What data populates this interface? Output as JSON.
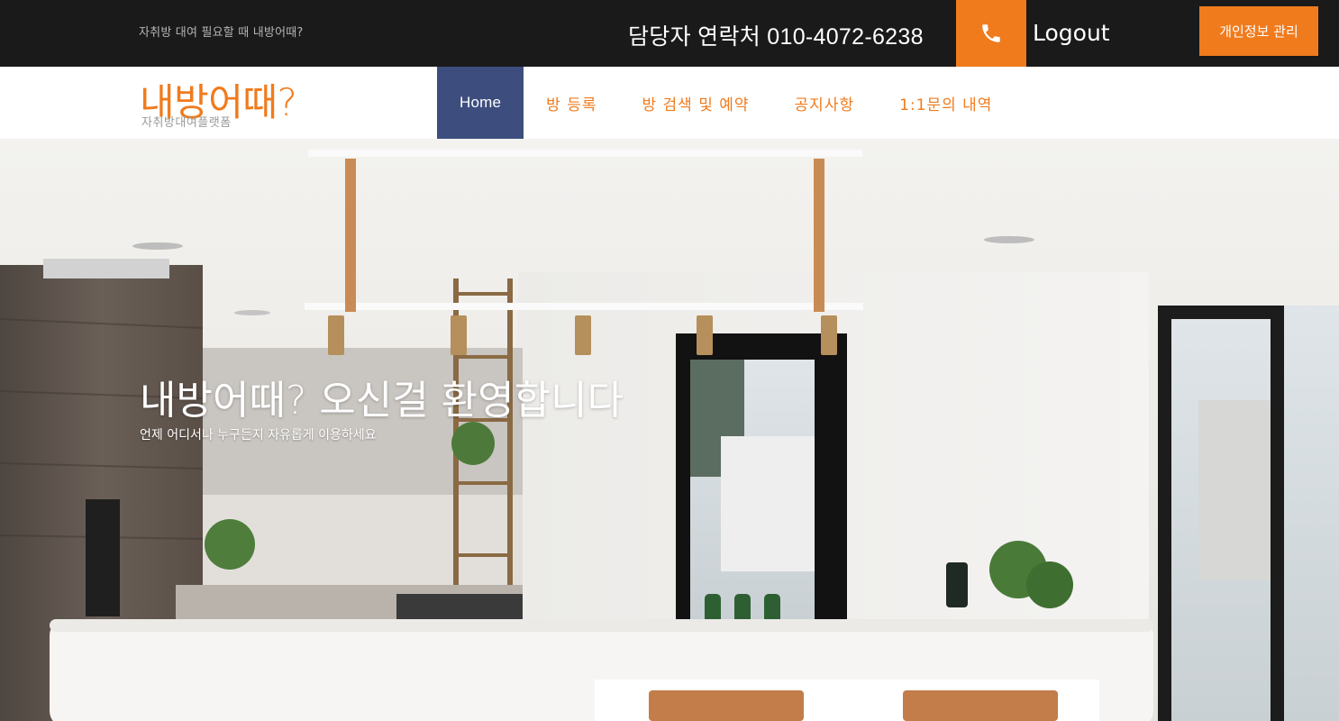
{
  "topbar": {
    "tagline": "자취방 대여 필요할 때 내방어때?",
    "contact": "담당자 연락처 010-4072-6238",
    "phone_icon": "phone-icon",
    "logout_label": "Logout",
    "profile_button": "개인정보 관리"
  },
  "header": {
    "logo_title": "내방어때?",
    "logo_subtitle": "자취방대여플랫폼",
    "nav": [
      {
        "label": "Home",
        "active": true
      },
      {
        "label": "방 등록",
        "active": false
      },
      {
        "label": "방 검색 및 예약",
        "active": false
      },
      {
        "label": "공지사항",
        "active": false
      },
      {
        "label": "1:1문의 내역",
        "active": false
      }
    ]
  },
  "hero": {
    "title": "내방어때? 오신걸 환영합니다",
    "subtitle": "언제 어디서나 누구든지 자유롭게 이용하세요"
  },
  "colors": {
    "topbar_bg": "#1a1a1a",
    "accent": "#f07b1d",
    "nav_active_bg": "#3d4e7e"
  }
}
